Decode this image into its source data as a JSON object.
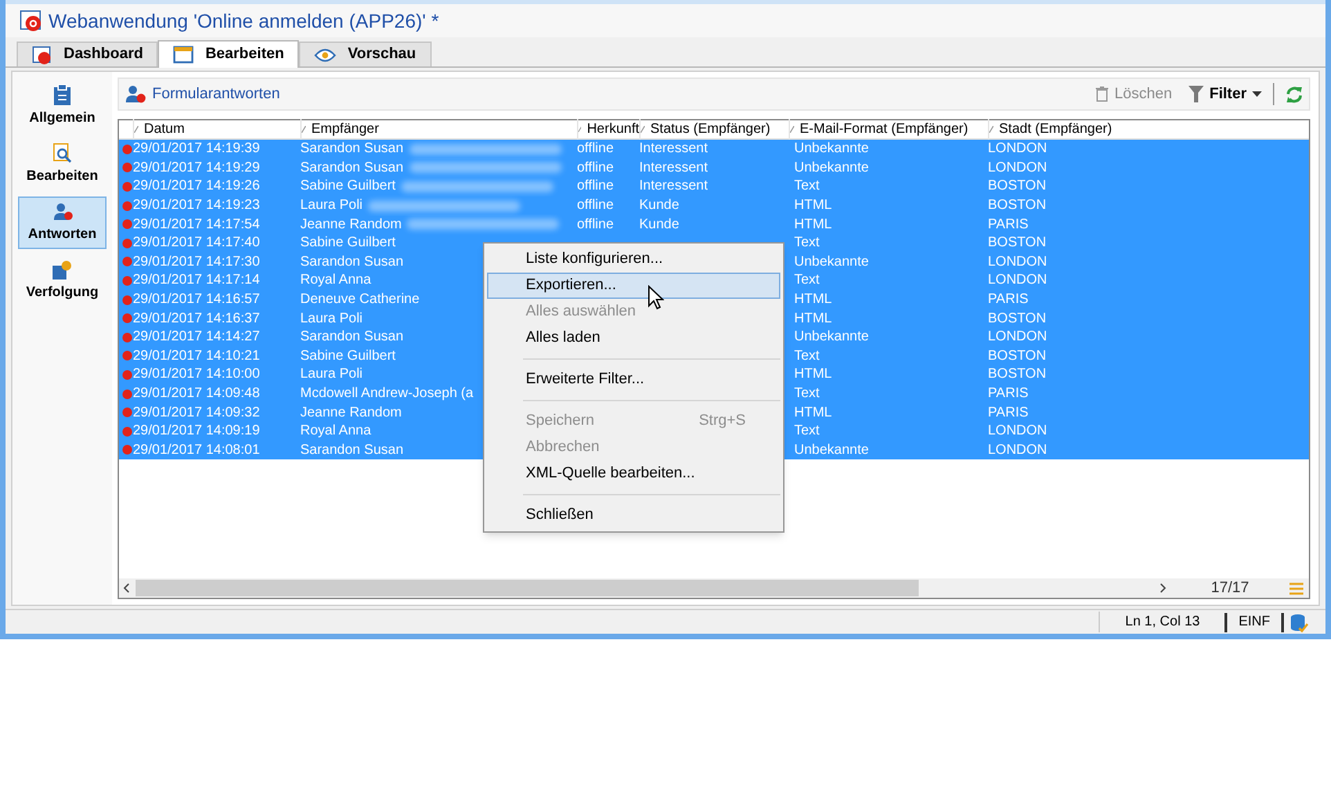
{
  "window": {
    "title": "Webanwendung 'Online anmelden (APP26)' *"
  },
  "tabs": [
    {
      "label": "Dashboard",
      "selected": false,
      "kind": "dashboard"
    },
    {
      "label": "Bearbeiten",
      "selected": true,
      "kind": "edit"
    },
    {
      "label": "Vorschau",
      "selected": false,
      "kind": "preview"
    }
  ],
  "sidebar": {
    "items": [
      {
        "label": "Allgemein",
        "selected": false,
        "kind": "clipboard"
      },
      {
        "label": "Bearbeiten",
        "selected": false,
        "kind": "edit"
      },
      {
        "label": "Antworten",
        "selected": true,
        "kind": "answers"
      },
      {
        "label": "Verfolgung",
        "selected": false,
        "kind": "tracking"
      }
    ]
  },
  "toolbar": {
    "title": "Formularantworten",
    "delete": "Löschen",
    "filter": "Filter"
  },
  "table": {
    "columns": [
      "Datum",
      "Empfänger",
      "Herkunft",
      "Status (Empfänger)",
      "E-Mail-Format (Empfänger)",
      "Stadt (Empfänger)"
    ],
    "rows": [
      {
        "date": "29/01/2017 14:19:39",
        "recipient": "Sarandon Susan",
        "origin": "offline",
        "status": "Interessent",
        "format": "Unbekannte",
        "city": "LONDON",
        "selected": true
      },
      {
        "date": "29/01/2017 14:19:29",
        "recipient": "Sarandon Susan",
        "origin": "offline",
        "status": "Interessent",
        "format": "Unbekannte",
        "city": "LONDON",
        "selected": true
      },
      {
        "date": "29/01/2017 14:19:26",
        "recipient": "Sabine Guilbert",
        "origin": "offline",
        "status": "Interessent",
        "format": "Text",
        "city": "BOSTON",
        "selected": true
      },
      {
        "date": "29/01/2017 14:19:23",
        "recipient": "Laura Poli",
        "origin": "offline",
        "status": "Kunde",
        "format": "HTML",
        "city": "BOSTON",
        "selected": true
      },
      {
        "date": "29/01/2017 14:17:54",
        "recipient": "Jeanne Random",
        "origin": "offline",
        "status": "Kunde",
        "format": "HTML",
        "city": "PARIS",
        "selected": true
      },
      {
        "date": "29/01/2017 14:17:40",
        "recipient": "Sabine Guilbert",
        "format": "Text",
        "city": "BOSTON",
        "selected": true
      },
      {
        "date": "29/01/2017 14:17:30",
        "recipient": "Sarandon Susan",
        "format": "Unbekannte",
        "city": "LONDON",
        "selected": true
      },
      {
        "date": "29/01/2017 14:17:14",
        "recipient": "Royal Anna",
        "format": "Text",
        "city": "LONDON",
        "selected": true
      },
      {
        "date": "29/01/2017 14:16:57",
        "recipient": "Deneuve Catherine",
        "format": "HTML",
        "city": "PARIS",
        "selected": true
      },
      {
        "date": "29/01/2017 14:16:37",
        "recipient": "Laura Poli",
        "format": "HTML",
        "city": "BOSTON",
        "selected": true
      },
      {
        "date": "29/01/2017 14:14:27",
        "recipient": "Sarandon Susan",
        "format": "Unbekannte",
        "city": "LONDON",
        "selected": true
      },
      {
        "date": "29/01/2017 14:10:21",
        "recipient": "Sabine Guilbert",
        "format": "Text",
        "city": "BOSTON",
        "selected": true
      },
      {
        "date": "29/01/2017 14:10:00",
        "recipient": "Laura Poli",
        "format": "HTML",
        "city": "BOSTON",
        "selected": true
      },
      {
        "date": "29/01/2017 14:09:48",
        "recipient": "Mcdowell Andrew-Joseph (a",
        "format": "Text",
        "city": "PARIS",
        "selected": true
      },
      {
        "date": "29/01/2017 14:09:32",
        "recipient": "Jeanne Random",
        "format": "HTML",
        "city": "PARIS",
        "selected": true
      },
      {
        "date": "29/01/2017 14:09:19",
        "recipient": "Royal Anna",
        "format": "Text",
        "city": "LONDON",
        "selected": true
      },
      {
        "date": "29/01/2017 14:08:01",
        "recipient": "Sarandon Susan",
        "format": "Unbekannte",
        "city": "LONDON",
        "selected": true
      }
    ],
    "count": "17/17"
  },
  "context_menu": {
    "items": [
      {
        "kind": "item",
        "label": "Liste konfigurieren...",
        "selected": false,
        "disabled": false
      },
      {
        "kind": "item",
        "label": "Exportieren...",
        "selected": true,
        "disabled": false
      },
      {
        "kind": "item",
        "label": "Alles auswählen",
        "selected": false,
        "disabled": true
      },
      {
        "kind": "item",
        "label": "Alles laden",
        "selected": false,
        "disabled": false
      },
      {
        "kind": "separator"
      },
      {
        "kind": "item",
        "label": "Erweiterte Filter...",
        "selected": false,
        "disabled": false
      },
      {
        "kind": "separator"
      },
      {
        "kind": "item",
        "label": "Speichern",
        "shortcut": "Strg+S",
        "selected": false,
        "disabled": true
      },
      {
        "kind": "item",
        "label": "Abbrechen",
        "selected": false,
        "disabled": true
      },
      {
        "kind": "item",
        "label": "XML-Quelle bearbeiten...",
        "selected": false,
        "disabled": false
      },
      {
        "kind": "separator"
      },
      {
        "kind": "item",
        "label": "Schließen",
        "selected": false,
        "disabled": false
      }
    ]
  },
  "status_bar": {
    "position": "Ln 1, Col 13",
    "mode": "EINF"
  }
}
